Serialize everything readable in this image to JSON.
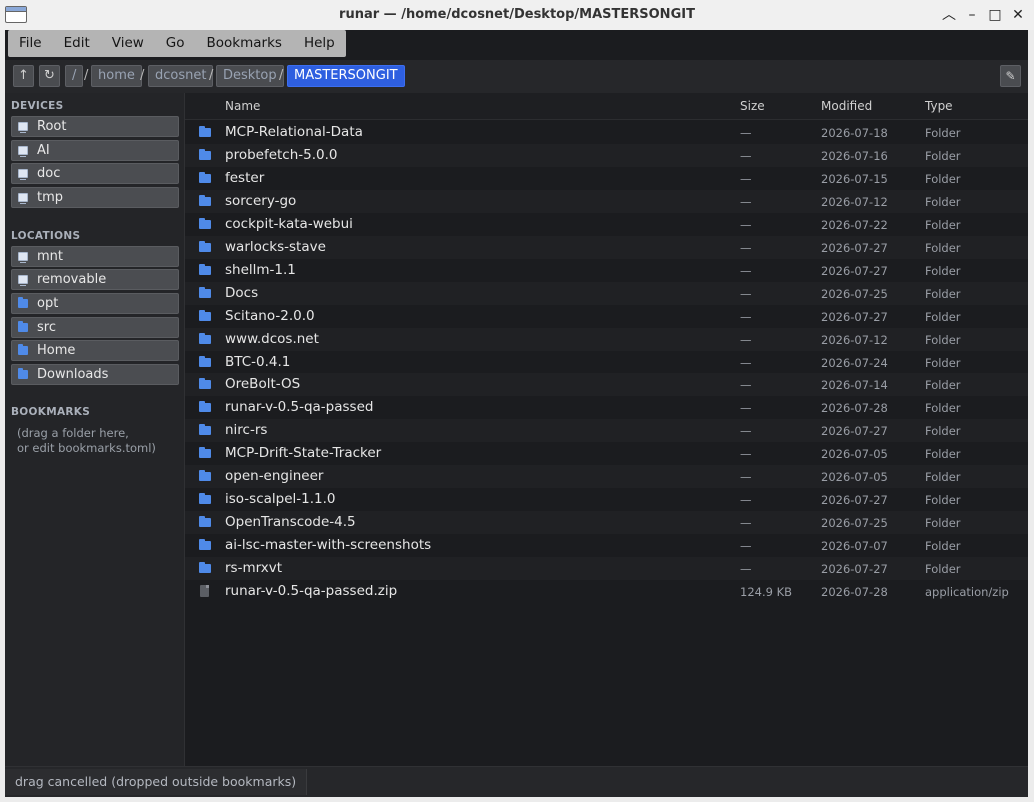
{
  "window": {
    "title": "runar — /home/dcosnet/Desktop/MASTERSONGIT",
    "controls": {
      "minimize": "minimize-icon",
      "maximize": "maximize-icon",
      "close": "close-icon",
      "shade": "chevron-up-icon"
    }
  },
  "menu": [
    "File",
    "Edit",
    "View",
    "Go",
    "Bookmarks",
    "Help"
  ],
  "pathbar": {
    "up_icon": "↑",
    "refresh_icon": "↻",
    "edit_icon": "✎",
    "crumbs": [
      "/",
      "home",
      "dcosnet",
      "Desktop",
      "MASTERSONGIT"
    ],
    "separator": "/"
  },
  "sidebar": {
    "devices_title": "DEVICES",
    "devices": [
      "Root",
      "AI",
      "doc",
      "tmp"
    ],
    "locations_title": "LOCATIONS",
    "locations": [
      {
        "label": "mnt",
        "icon": "drive-icon"
      },
      {
        "label": "removable",
        "icon": "drive-icon"
      },
      {
        "label": "opt",
        "icon": "folder-icon"
      },
      {
        "label": "src",
        "icon": "folder-icon"
      },
      {
        "label": "Home",
        "icon": "folder-icon"
      },
      {
        "label": "Downloads",
        "icon": "folder-icon"
      }
    ],
    "bookmarks_title": "BOOKMARKS",
    "bookmarks_hint_1": "(drag a folder here,",
    "bookmarks_hint_2": "or edit bookmarks.toml)"
  },
  "columns": {
    "name": "Name",
    "size": "Size",
    "modified": "Modified",
    "type": "Type"
  },
  "files": [
    {
      "name": "MCP-Relational-Data",
      "size": "—",
      "modified": "2026-07-18",
      "type": "Folder",
      "icon": "folder-icon"
    },
    {
      "name": "probefetch-5.0.0",
      "size": "—",
      "modified": "2026-07-16",
      "type": "Folder",
      "icon": "folder-icon"
    },
    {
      "name": "fester",
      "size": "—",
      "modified": "2026-07-15",
      "type": "Folder",
      "icon": "folder-icon"
    },
    {
      "name": "sorcery-go",
      "size": "—",
      "modified": "2026-07-12",
      "type": "Folder",
      "icon": "folder-icon"
    },
    {
      "name": "cockpit-kata-webui",
      "size": "—",
      "modified": "2026-07-22",
      "type": "Folder",
      "icon": "folder-icon"
    },
    {
      "name": "warlocks-stave",
      "size": "—",
      "modified": "2026-07-27",
      "type": "Folder",
      "icon": "folder-icon"
    },
    {
      "name": "shellm-1.1",
      "size": "—",
      "modified": "2026-07-27",
      "type": "Folder",
      "icon": "folder-icon"
    },
    {
      "name": "Docs",
      "size": "—",
      "modified": "2026-07-25",
      "type": "Folder",
      "icon": "folder-icon"
    },
    {
      "name": "Scitano-2.0.0",
      "size": "—",
      "modified": "2026-07-27",
      "type": "Folder",
      "icon": "folder-icon"
    },
    {
      "name": "www.dcos.net",
      "size": "—",
      "modified": "2026-07-12",
      "type": "Folder",
      "icon": "folder-icon"
    },
    {
      "name": "BTC-0.4.1",
      "size": "—",
      "modified": "2026-07-24",
      "type": "Folder",
      "icon": "folder-icon"
    },
    {
      "name": "OreBolt-OS",
      "size": "—",
      "modified": "2026-07-14",
      "type": "Folder",
      "icon": "folder-icon"
    },
    {
      "name": "runar-v-0.5-qa-passed",
      "size": "—",
      "modified": "2026-07-28",
      "type": "Folder",
      "icon": "folder-icon"
    },
    {
      "name": "nirc-rs",
      "size": "—",
      "modified": "2026-07-27",
      "type": "Folder",
      "icon": "folder-icon"
    },
    {
      "name": "MCP-Drift-State-Tracker",
      "size": "—",
      "modified": "2026-07-05",
      "type": "Folder",
      "icon": "folder-icon"
    },
    {
      "name": "open-engineer",
      "size": "—",
      "modified": "2026-07-05",
      "type": "Folder",
      "icon": "folder-icon"
    },
    {
      "name": "iso-scalpel-1.1.0",
      "size": "—",
      "modified": "2026-07-27",
      "type": "Folder",
      "icon": "folder-icon"
    },
    {
      "name": "OpenTranscode-4.5",
      "size": "—",
      "modified": "2026-07-25",
      "type": "Folder",
      "icon": "folder-icon"
    },
    {
      "name": "ai-lsc-master-with-screenshots",
      "size": "—",
      "modified": "2026-07-07",
      "type": "Folder",
      "icon": "folder-icon"
    },
    {
      "name": "rs-mrxvt",
      "size": "—",
      "modified": "2026-07-27",
      "type": "Folder",
      "icon": "folder-icon"
    },
    {
      "name": "runar-v-0.5-qa-passed.zip",
      "size": "124.9 KB",
      "modified": "2026-07-28",
      "type": "application/zip",
      "icon": "file-icon"
    }
  ],
  "status": {
    "text": "drag cancelled (dropped outside bookmarks)"
  },
  "colors": {
    "accent": "#2e5fe0",
    "folder": "#4f8ae8",
    "background": "#1b1c1f"
  }
}
